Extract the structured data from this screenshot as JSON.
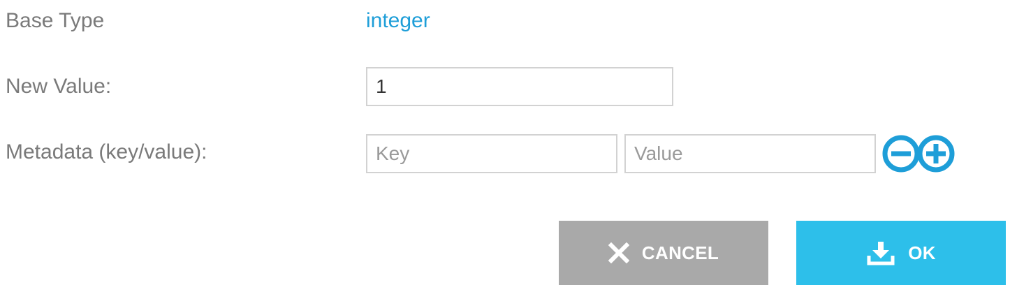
{
  "form": {
    "base_type_label": "Base Type",
    "base_type_value": "integer",
    "new_value_label": "New Value:",
    "new_value": "1",
    "metadata_label": "Metadata (key/value):",
    "key_placeholder": "Key",
    "value_placeholder": "Value"
  },
  "actions": {
    "cancel_label": "CANCEL",
    "ok_label": "OK"
  },
  "icons": {
    "remove": "minus-circle-icon",
    "add": "plus-circle-icon",
    "cancel": "x-icon",
    "ok": "download-icon"
  },
  "colors": {
    "accent": "#1e9ed8",
    "ok_button": "#2dbfea",
    "cancel_button": "#a9a9a9",
    "label_text": "#7a7a7a"
  }
}
